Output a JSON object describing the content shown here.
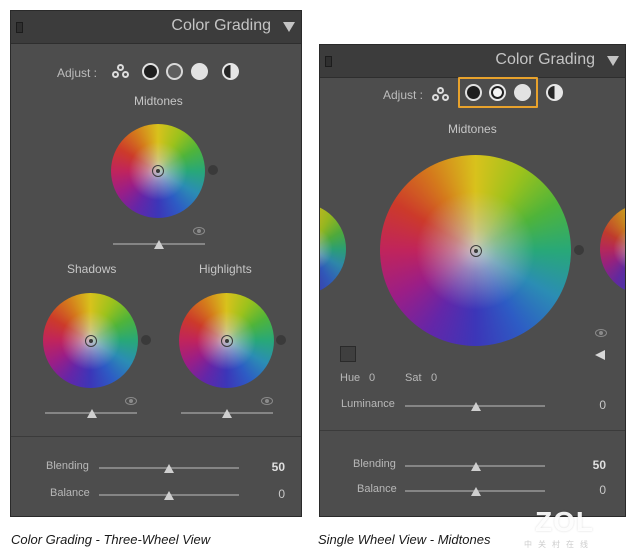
{
  "left_panel": {
    "title": "Color Grading",
    "adjust_label": "Adjust :",
    "midtones_label": "Midtones",
    "shadows_label": "Shadows",
    "highlights_label": "Highlights",
    "blending_label": "Blending",
    "blending_value": "50",
    "balance_label": "Balance",
    "balance_value": "0",
    "slider_levels": {
      "midtones_luminance": 0.5,
      "shadows_luminance": 0.5,
      "highlights_luminance": 0.5,
      "blending": 0.5,
      "balance": 0.5
    }
  },
  "right_panel": {
    "title": "Color Grading",
    "adjust_label": "Adjust :",
    "midtones_label": "Midtones",
    "hue_label": "Hue",
    "hue_value": "0",
    "sat_label": "Sat",
    "sat_value": "0",
    "luminance_label": "Luminance",
    "luminance_value": "0",
    "blending_label": "Blending",
    "blending_value": "50",
    "balance_label": "Balance",
    "balance_value": "0",
    "selected_mode": "midtones",
    "slider_levels": {
      "luminance": 0.5,
      "blending": 0.5,
      "balance": 0.5
    }
  },
  "captions": {
    "left": "Color Grading - Three-Wheel View",
    "right": "Single Wheel View - Midtones"
  },
  "watermark": {
    "logo": "ZOL",
    "tagline": "中关村在线"
  },
  "colors": {
    "panel_bg": "#4d4d4d",
    "header_bg": "#3c3c3c",
    "selection_accent": "#e8a22c"
  },
  "icons": {
    "header_collapse": "triangle-down-icon",
    "all_wheels": "three-circles-icon",
    "shadows_mode": "dark-circle-icon",
    "midtones_mode": "mid-circle-icon",
    "highlights_mode": "light-circle-icon",
    "global_mode": "half-circle-icon",
    "visibility": "eye-icon",
    "color_swatch": "swatch-icon",
    "expand": "left-triangle-icon"
  }
}
